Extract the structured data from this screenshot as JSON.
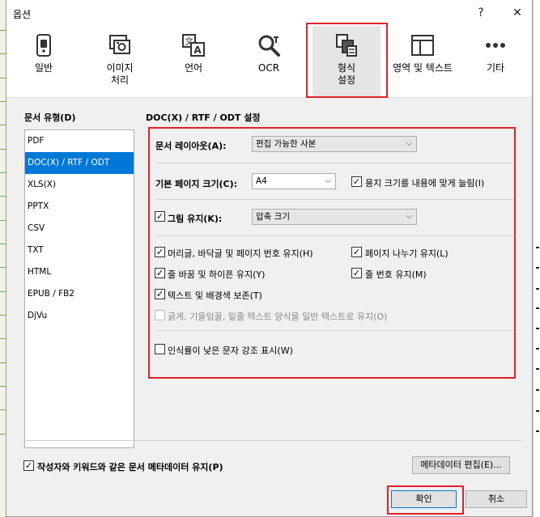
{
  "dialog": {
    "title": "옵션",
    "help_glyph": "?",
    "close_glyph": "✕"
  },
  "toolbar": {
    "items": [
      {
        "label": "일반",
        "icon": "general-settings-icon"
      },
      {
        "label": "이미지\n처리",
        "icon": "image-processing-icon"
      },
      {
        "label": "언어",
        "icon": "language-icon"
      },
      {
        "label": "OCR",
        "icon": "ocr-magnifier-icon"
      },
      {
        "label": "형식\n설정",
        "icon": "format-settings-icon"
      },
      {
        "label": "영역 및 텍스트",
        "icon": "areas-text-icon"
      },
      {
        "label": "기타",
        "icon": "more-icon"
      }
    ],
    "active": "형식 설정"
  },
  "doc_types": {
    "title": "문서 유형(D)",
    "items": [
      "PDF",
      "DOC(X) / RTF / ODT",
      "XLS(X)",
      "PPTX",
      "CSV",
      "TXT",
      "HTML",
      "EPUB / FB2",
      "DjVu"
    ],
    "selected": "DOC(X) / RTF / ODT"
  },
  "settings": {
    "title": "DOC(X) / RTF / ODT 설정",
    "layout_label": "문서 레이아웃(A):",
    "layout_value": "편집 가능한 사본",
    "page_size_label": "기본 페이지 크기(C):",
    "page_size_value": "A4",
    "fit_paper_label": "용지 크기를 내용에 맞게 늘림(I)",
    "fit_paper_checked": true,
    "keep_pictures_label": "그림 유지(K):",
    "keep_pictures_checked": true,
    "picture_quality_value": "압축 크기",
    "keep_headers_label": "머리글, 바닥글 및 페이지 번호 유지(H)",
    "keep_headers_checked": true,
    "keep_page_breaks_label": "페이지 나누기 유지(L)",
    "keep_page_breaks_checked": true,
    "keep_line_breaks_label": "줄 바꿈 및 하이픈 유지(Y)",
    "keep_line_breaks_checked": true,
    "keep_line_numbers_label": "줄 번호 유지(M)",
    "keep_line_numbers_checked": true,
    "keep_colors_label": "텍스트 및 배경색 보존(T)",
    "keep_colors_checked": true,
    "plain_text_label": "굵게, 기울임꼴, 밑줄 텍스트 양식을 일반 텍스트로 유지(O)",
    "plain_text_checked": false,
    "highlight_label": "인식률이 낮은 문자 강조 표시(W)",
    "highlight_checked": false
  },
  "footer": {
    "metadata_label": "작성자와 키워드와 같은 문서 메타데이터 유지(P)",
    "metadata_checked": true,
    "edit_metadata_button": "메타데이터 편집(E)...",
    "ok_button": "확인",
    "cancel_button": "취소"
  },
  "colors": {
    "highlight_red": "#e0202a",
    "selection_blue": "#0078d7",
    "dialog_bg": "#f0f0f0"
  }
}
